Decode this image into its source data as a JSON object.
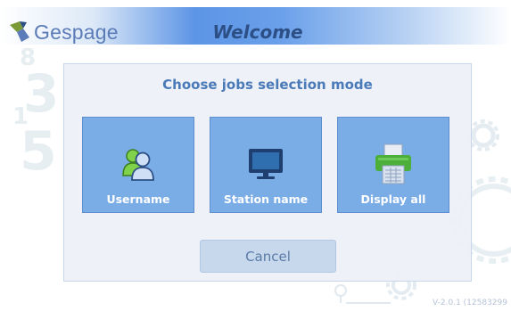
{
  "header": {
    "logo_text": "Gespage",
    "title": "Welcome"
  },
  "dialog": {
    "title": "Choose jobs selection mode",
    "buttons": [
      {
        "label": "Username",
        "icon": "users-icon"
      },
      {
        "label": "Station name",
        "icon": "monitor-icon"
      },
      {
        "label": "Display all",
        "icon": "printer-icon"
      }
    ],
    "cancel_label": "Cancel"
  },
  "footer": {
    "version": "V-2.0.1 (12583299"
  },
  "colors": {
    "header_title": "#2c4f85",
    "dialog_title": "#4a7ab8",
    "mode_button_bg": "#7aace6",
    "cancel_bg": "#c7d8ec"
  }
}
